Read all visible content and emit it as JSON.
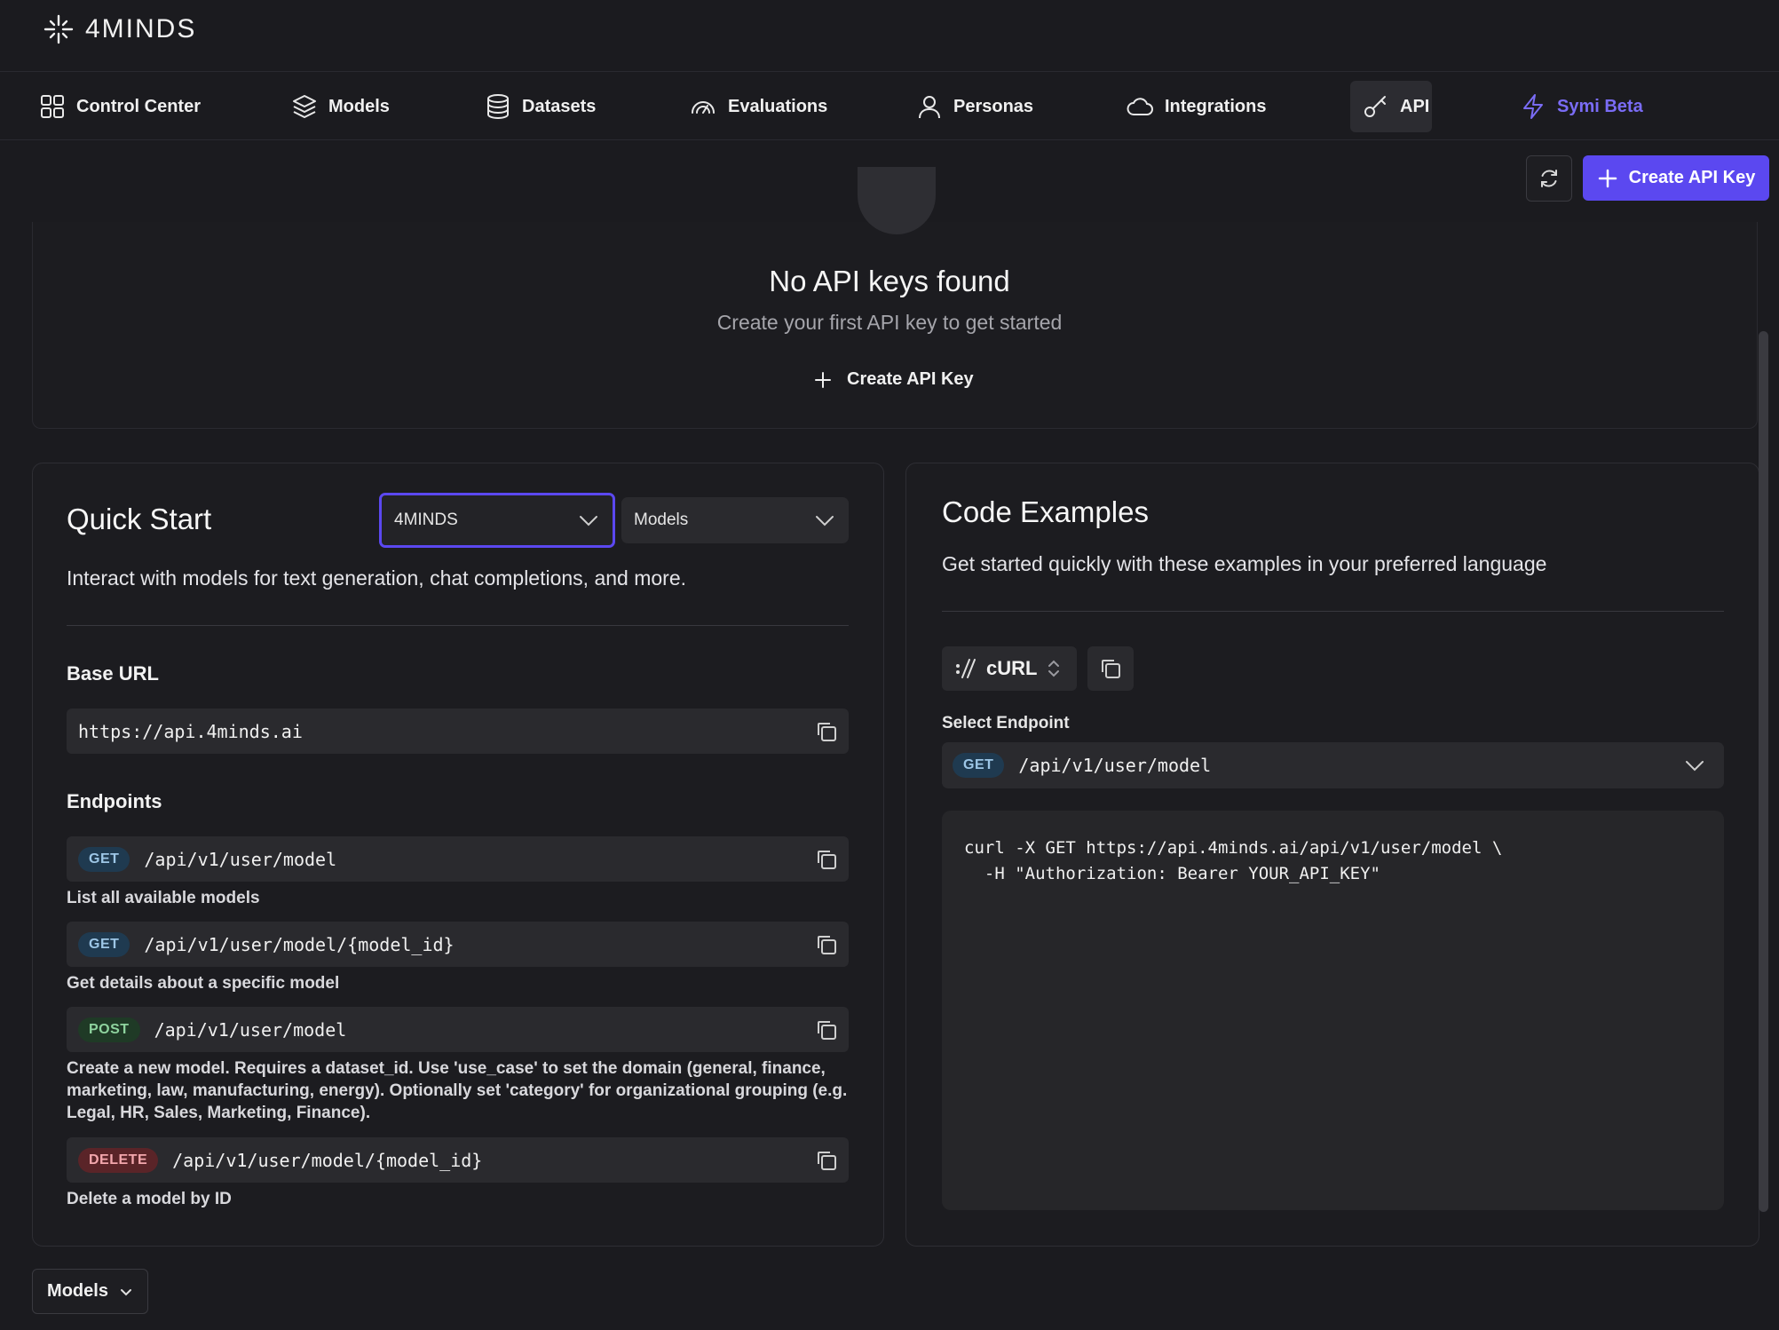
{
  "brand": {
    "name": "4MINDS"
  },
  "nav": {
    "items": [
      {
        "label": "Control Center",
        "icon": "grid-icon"
      },
      {
        "label": "Models",
        "icon": "layers-icon"
      },
      {
        "label": "Datasets",
        "icon": "database-icon"
      },
      {
        "label": "Evaluations",
        "icon": "gauge-icon"
      },
      {
        "label": "Personas",
        "icon": "user-icon"
      },
      {
        "label": "Integrations",
        "icon": "cloud-icon"
      },
      {
        "label": "API",
        "icon": "key-icon",
        "active": true
      },
      {
        "label": "Symi Beta",
        "icon": "bolt-icon"
      }
    ]
  },
  "actions": {
    "create_label": "Create API Key"
  },
  "empty_state": {
    "title": "No API keys found",
    "subtitle": "Create your first API key to get started",
    "cta": "Create API Key"
  },
  "quick_start": {
    "title": "Quick Start",
    "provider_select": "4MINDS",
    "category_select": "Models",
    "description": "Interact with models for text generation, chat completions, and more.",
    "base_url_label": "Base URL",
    "base_url": "https://api.4minds.ai",
    "endpoints_label": "Endpoints",
    "endpoints": [
      {
        "method": "GET",
        "path": "/api/v1/user/model",
        "description": "List all available models"
      },
      {
        "method": "GET",
        "path": "/api/v1/user/model/{model_id}",
        "description": "Get details about a specific model"
      },
      {
        "method": "POST",
        "path": "/api/v1/user/model",
        "description": "Create a new model. Requires a dataset_id. Use 'use_case' to set the domain (general, finance, marketing, law, manufacturing, energy). Optionally set 'category' for organizational grouping (e.g. Legal, HR, Sales, Marketing, Finance)."
      },
      {
        "method": "DELETE",
        "path": "/api/v1/user/model/{model_id}",
        "description": "Delete a model by ID"
      }
    ]
  },
  "code_examples": {
    "title": "Code Examples",
    "subtitle": "Get started quickly with these examples in your preferred language",
    "language": "cURL",
    "select_endpoint_label": "Select Endpoint",
    "selected_method": "GET",
    "selected_path": "/api/v1/user/model",
    "code": "curl -X GET https://api.4minds.ai/api/v1/user/model \\\n  -H \"Authorization: Bearer YOUR_API_KEY\""
  },
  "footer": {
    "models_button": "Models"
  },
  "colors": {
    "accent": "#5b48f0",
    "background": "#1b1b1f"
  }
}
